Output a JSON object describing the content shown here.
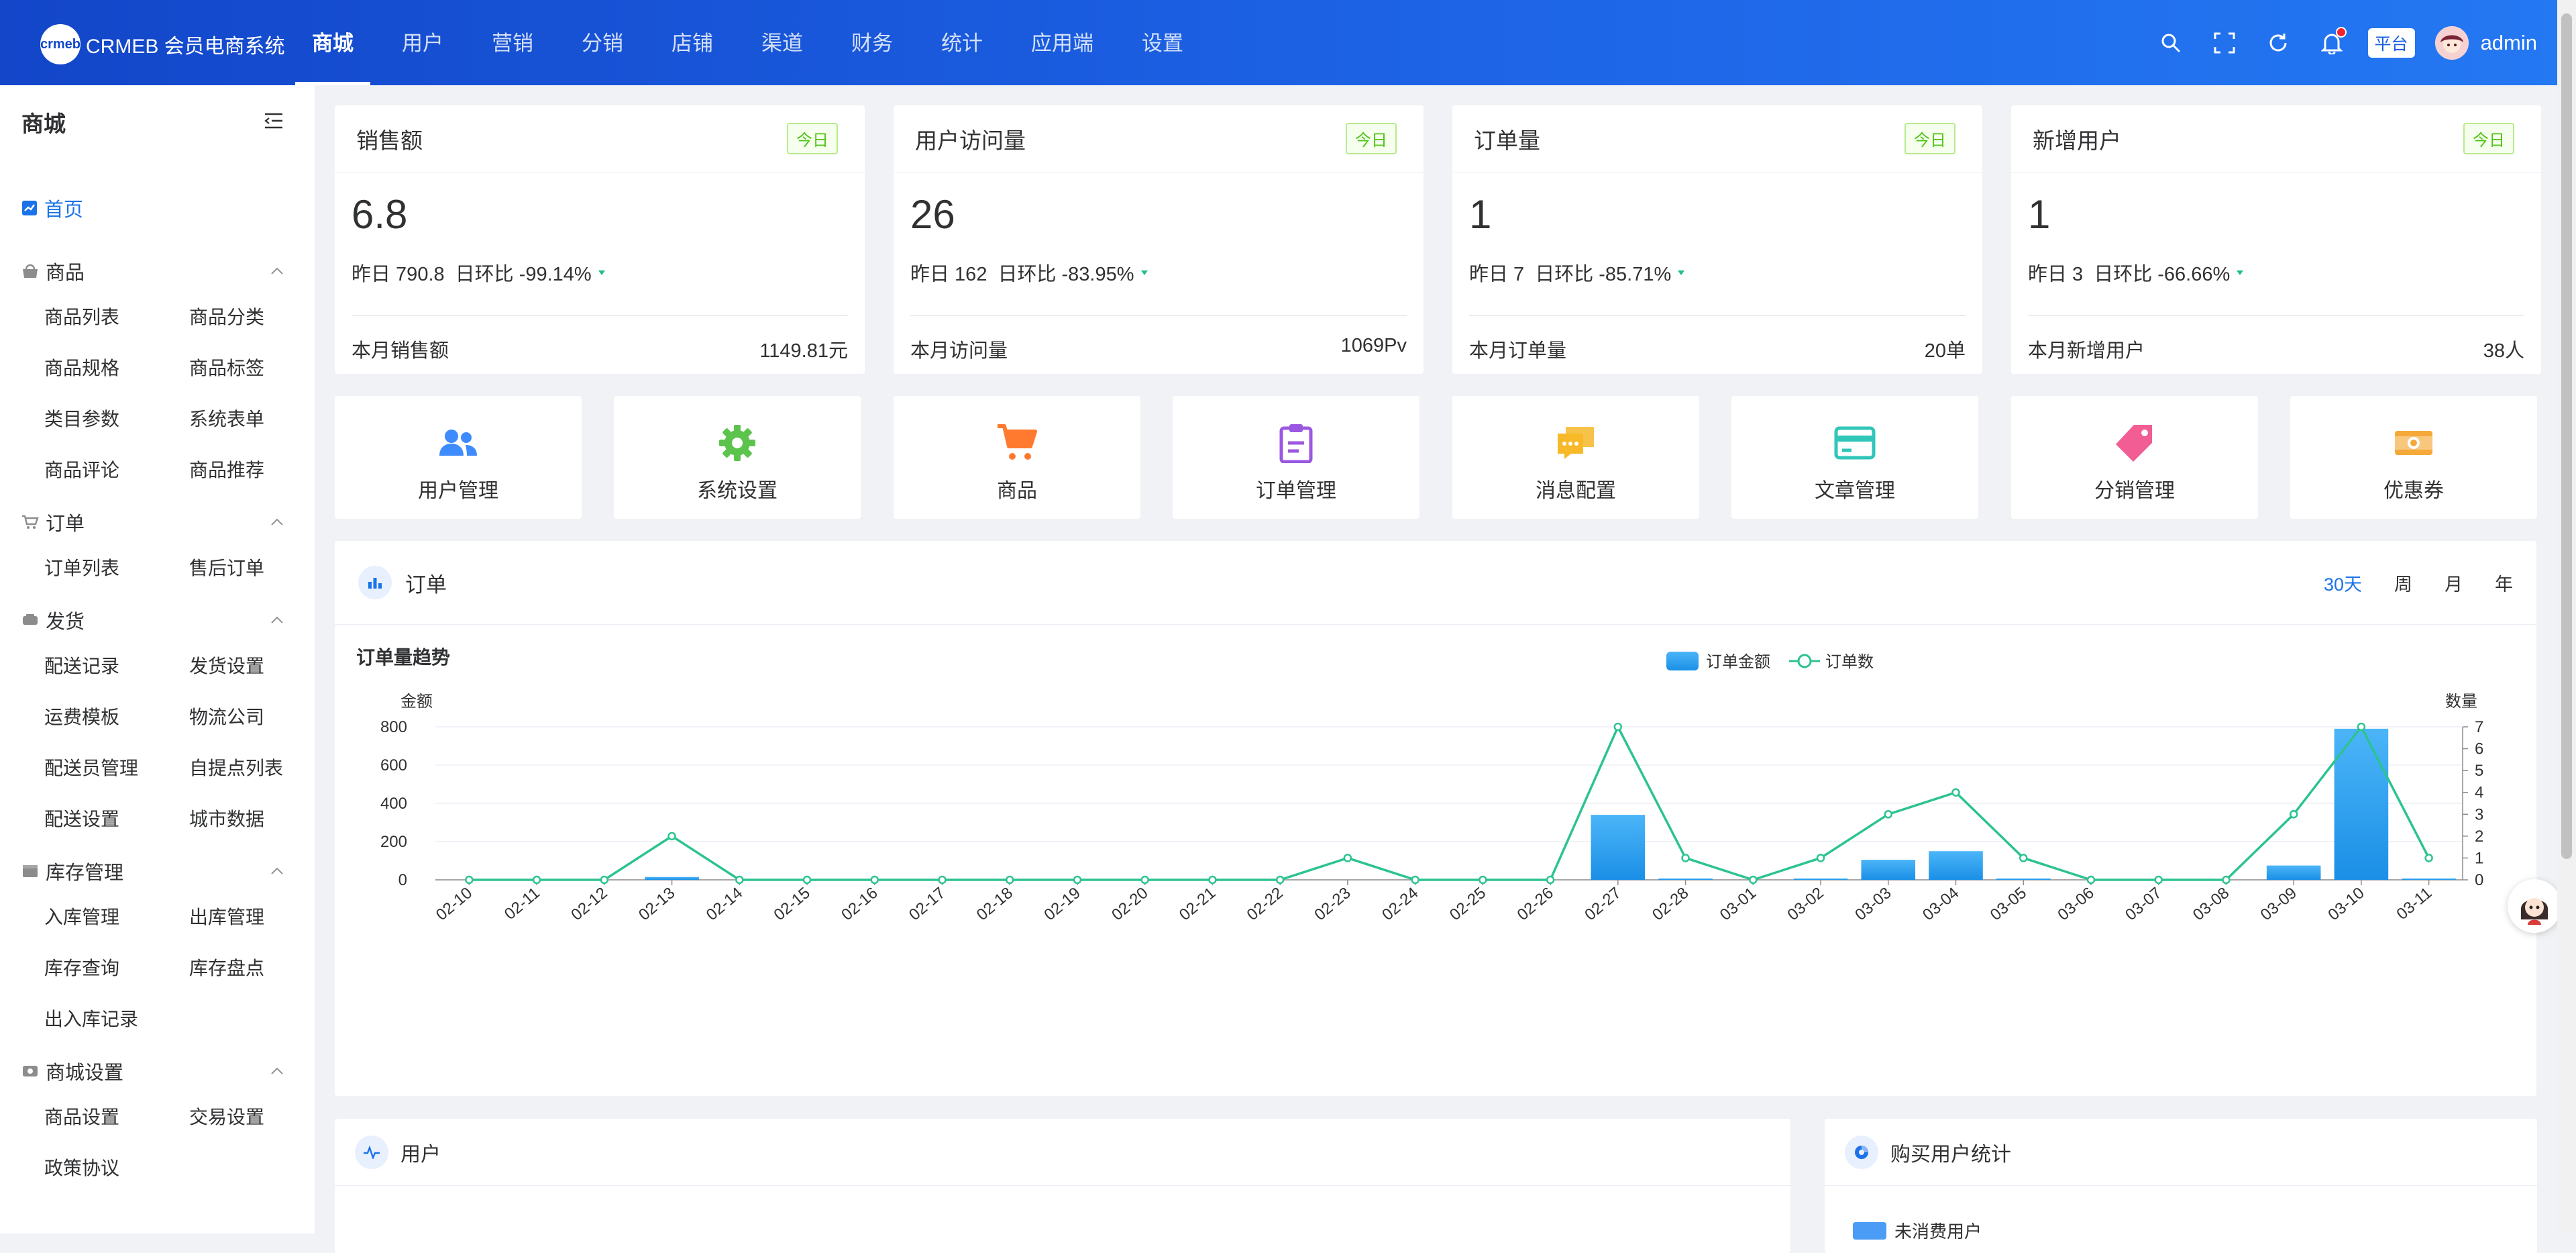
{
  "brand": {
    "logo_text": "crmeb",
    "name": "CRMEB 会员电商系统"
  },
  "top_menu": [
    "商城",
    "用户",
    "营销",
    "分销",
    "店铺",
    "渠道",
    "财务",
    "统计",
    "应用端",
    "设置"
  ],
  "top_right": {
    "platform_tag": "平台",
    "username": "admin"
  },
  "sidebar": {
    "title": "商城",
    "home": "首页",
    "groups": [
      {
        "name": "商品",
        "icon": "shop-icon",
        "items": [
          "商品列表",
          "商品分类",
          "商品规格",
          "商品标签",
          "类目参数",
          "系统表单",
          "商品评论",
          "商品推荐"
        ]
      },
      {
        "name": "订单",
        "icon": "cart-icon",
        "items": [
          "订单列表",
          "售后订单"
        ]
      },
      {
        "name": "发货",
        "icon": "truck-icon",
        "items": [
          "配送记录",
          "发货设置",
          "运费模板",
          "物流公司",
          "配送员管理",
          "自提点列表",
          "配送设置",
          "城市数据"
        ]
      },
      {
        "name": "库存管理",
        "icon": "warehouse-icon",
        "items": [
          "入库管理",
          "出库管理",
          "库存查询",
          "库存盘点",
          "出入库记录"
        ]
      },
      {
        "name": "商城设置",
        "icon": "settings-icon",
        "items": [
          "商品设置",
          "交易设置",
          "政策协议"
        ]
      }
    ]
  },
  "stats": [
    {
      "title": "销售额",
      "tag": "今日",
      "value": "6.8",
      "yesterday": "昨日 790.8",
      "ratio": "日环比 -99.14%",
      "month_label": "本月销售额",
      "month_value": "1149.81元"
    },
    {
      "title": "用户访问量",
      "tag": "今日",
      "value": "26",
      "yesterday": "昨日 162",
      "ratio": "日环比 -83.95%",
      "month_label": "本月访问量",
      "month_value": "1069Pv"
    },
    {
      "title": "订单量",
      "tag": "今日",
      "value": "1",
      "yesterday": "昨日 7",
      "ratio": "日环比 -85.71%",
      "month_label": "本月订单量",
      "month_value": "20单"
    },
    {
      "title": "新增用户",
      "tag": "今日",
      "value": "1",
      "yesterday": "昨日 3",
      "ratio": "日环比 -66.66%",
      "month_label": "本月新增用户",
      "month_value": "38人"
    }
  ],
  "quick_links": [
    {
      "label": "用户管理",
      "icon": "users-icon",
      "color": "#3d8bfd"
    },
    {
      "label": "系统设置",
      "icon": "gear-icon",
      "color": "#5cc44d"
    },
    {
      "label": "商品",
      "icon": "cart-icon",
      "color": "#ff7a2e"
    },
    {
      "label": "订单管理",
      "icon": "clipboard-icon",
      "color": "#9b58e0"
    },
    {
      "label": "消息配置",
      "icon": "message-icon",
      "color": "#f7b928"
    },
    {
      "label": "文章管理",
      "icon": "card-icon",
      "color": "#30c6b9"
    },
    {
      "label": "分销管理",
      "icon": "tag-icon",
      "color": "#f25d93"
    },
    {
      "label": "优惠券",
      "icon": "coupon-icon",
      "color": "#f5a938"
    }
  ],
  "order_panel": {
    "title": "订单",
    "periods": [
      "30天",
      "周",
      "月",
      "年"
    ],
    "active_period": "30天"
  },
  "chart_data": {
    "type": "bar",
    "title": "订单量趋势",
    "categories": [
      "02-10",
      "02-11",
      "02-12",
      "02-13",
      "02-14",
      "02-15",
      "02-16",
      "02-17",
      "02-18",
      "02-19",
      "02-20",
      "02-21",
      "02-22",
      "02-23",
      "02-24",
      "02-25",
      "02-26",
      "02-27",
      "02-28",
      "03-01",
      "03-02",
      "03-03",
      "03-04",
      "03-05",
      "03-06",
      "03-07",
      "03-08",
      "03-09",
      "03-10",
      "03-11"
    ],
    "series": [
      {
        "name": "订单金额",
        "type": "bar",
        "axis": "left",
        "color": "#2c9cf0",
        "values": [
          0,
          0,
          0,
          15,
          0,
          0,
          0,
          0,
          0,
          0,
          0,
          0,
          0,
          0,
          0,
          0,
          0,
          340,
          3,
          0,
          3,
          105,
          150,
          3,
          0,
          0,
          0,
          75,
          790,
          4
        ]
      },
      {
        "name": "订单数",
        "type": "line",
        "axis": "right",
        "color": "#2cc38f",
        "values": [
          0,
          0,
          0,
          2,
          0,
          0,
          0,
          0,
          0,
          0,
          0,
          0,
          0,
          1,
          0,
          0,
          0,
          7,
          1,
          0,
          1,
          3,
          4,
          1,
          0,
          0,
          0,
          3,
          7,
          1
        ]
      }
    ],
    "y_left": {
      "label": "金额",
      "range": [
        0,
        800
      ],
      "ticks": [
        0,
        200,
        400,
        600,
        800
      ]
    },
    "y_right": {
      "label": "数量",
      "range": [
        0,
        7
      ],
      "ticks": [
        0,
        1,
        2,
        3,
        4,
        5,
        6,
        7
      ]
    },
    "legend_position": "top-center",
    "grid": true
  },
  "user_panel": {
    "title": "用户"
  },
  "buy_panel": {
    "title": "购买用户统计",
    "legend": [
      "未消费用户"
    ]
  },
  "colors": {
    "primary": "#1a73e8",
    "nav_start": "#1346c9",
    "nav_end": "#2478f2",
    "success": "#52c41a"
  }
}
